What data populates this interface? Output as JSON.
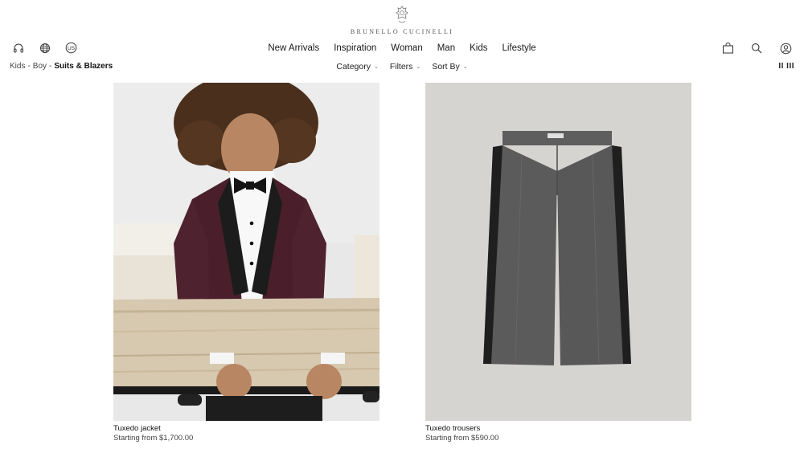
{
  "brand": {
    "name": "BRUNELLO CUCINELLI"
  },
  "header": {
    "left_icons": [
      "headset-icon",
      "globe-icon",
      "us-region-icon"
    ],
    "region_label": "US",
    "right_icons": [
      "shopping-bag-icon",
      "search-icon",
      "account-icon"
    ]
  },
  "nav": {
    "items": [
      "New Arrivals",
      "Inspiration",
      "Woman",
      "Man",
      "Kids",
      "Lifestyle"
    ]
  },
  "breadcrumb": {
    "items": [
      "Kids",
      "Boy"
    ],
    "current": "Suits & Blazers",
    "separator": "-"
  },
  "filters": {
    "category": "Category",
    "filters": "Filters",
    "sort_by": "Sort By"
  },
  "grid_toggle": {
    "label": "II III"
  },
  "products": [
    {
      "name": "Tuxedo jacket",
      "price": "Starting from $1,700.00"
    },
    {
      "name": "Tuxedo trousers",
      "price": "Starting from $590.00"
    }
  ],
  "colors": {
    "background": "#ffffff",
    "text": "#1a1a1a",
    "photo1_bg": "#e9e9e9",
    "photo2_bg": "#d6d4d1",
    "jacket": "#4a1f2b",
    "trousers": "#5b5b5b"
  }
}
